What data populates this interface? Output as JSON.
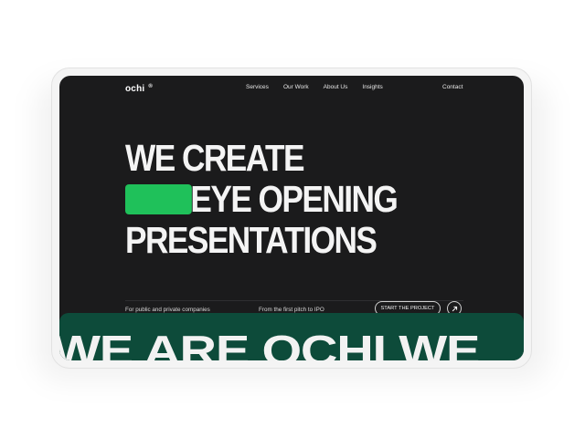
{
  "brand": {
    "logo": "ochi",
    "logo_mark": "®"
  },
  "nav": {
    "items": [
      "Services",
      "Our Work",
      "About Us",
      "Insights"
    ],
    "contact": "Contact"
  },
  "hero": {
    "line1": "WE CREATE",
    "line2": "EYE OPENING",
    "line3": "PRESENTATIONS"
  },
  "info": {
    "left": "For public and private companies",
    "middle": "From the first pitch to IPO",
    "cta": "START THE PROJECT"
  },
  "marquee": {
    "text": "WE ARE OCHI WE"
  },
  "colors": {
    "accent": "#1fc15a",
    "background": "#1b1b1c",
    "marquee_bg": "#0d4b3a"
  },
  "icons": {
    "cta_arrow": "arrow-up-right-icon"
  }
}
